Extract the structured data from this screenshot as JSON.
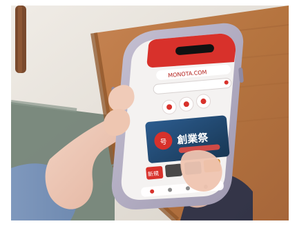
{
  "photo": {
    "subject": "Hand holding a smartphone over a wooden table",
    "colors": {
      "wood": "#b5743f",
      "wood_dark": "#8e552a",
      "floor": "#e7e2da",
      "rug": "#6d7e73",
      "sleeve": "#7b98bf",
      "skin": "#efc9b5",
      "phone_frame": "#b7b2c5",
      "screen_red": "#d8312b",
      "screen_bg": "#f4f2f1"
    }
  },
  "screen": {
    "url_text": "MONOTA.COM",
    "banner_text": "創業祭",
    "circle_text": "号",
    "badge_text": "新規"
  }
}
